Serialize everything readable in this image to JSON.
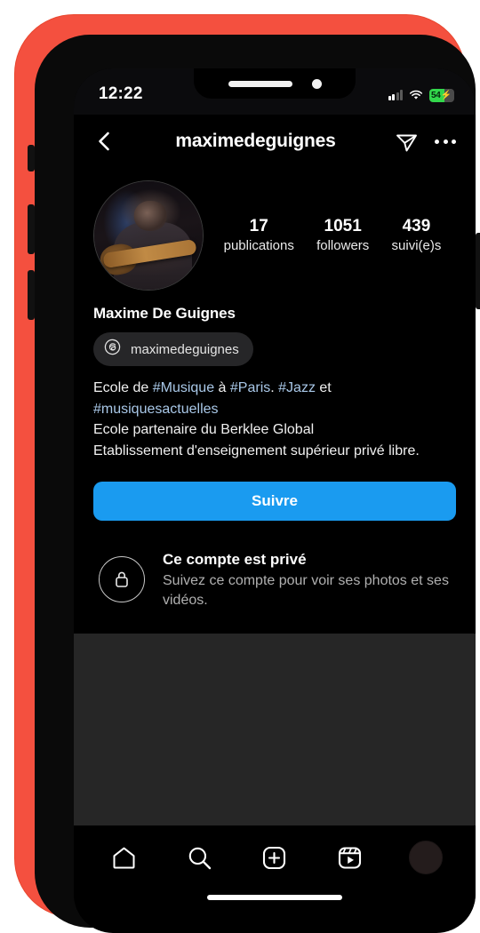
{
  "status_bar": {
    "time": "12:22",
    "battery_level": "54",
    "battery_charging_glyph": "⚡",
    "cellular_icon": "cellular-signal-icon",
    "wifi_icon": "wifi-icon"
  },
  "header": {
    "back_icon": "back-chevron-icon",
    "username": "maximedeguignes",
    "share_icon": "share-paper-plane-icon",
    "more_icon": "more-options-icon"
  },
  "profile": {
    "avatar_alt": "profile-photo-guitarist",
    "full_name": "Maxime De Guignes",
    "threads_handle": "maximedeguignes",
    "threads_icon": "threads-logo-icon",
    "stats": [
      {
        "value": "17",
        "label": "publications"
      },
      {
        "value": "1051",
        "label": "followers"
      },
      {
        "value": "439",
        "label": "suivi(e)s"
      }
    ],
    "bio_lines": [
      [
        {
          "t": "Ecole de ",
          "k": "plain"
        },
        {
          "t": "#Musique",
          "k": "tag"
        },
        {
          "t": " à ",
          "k": "plain"
        },
        {
          "t": "#Paris",
          "k": "tag"
        },
        {
          "t": ". ",
          "k": "plain"
        },
        {
          "t": "#Jazz",
          "k": "tag"
        },
        {
          "t": " et ",
          "k": "plain"
        },
        {
          "t": "#musiquesactuelles",
          "k": "tag"
        }
      ],
      [
        {
          "t": "Ecole partenaire du Berklee Global",
          "k": "plain"
        }
      ],
      [
        {
          "t": "Etablissement d'enseignement supérieur privé libre.",
          "k": "plain"
        }
      ]
    ],
    "follow_button_label": "Suivre",
    "follow_button_color": "#1A9BF0"
  },
  "private_notice": {
    "lock_icon": "lock-icon",
    "title": "Ce compte est privé",
    "subtitle": "Suivez ce compte pour voir ses photos et ses vidéos."
  },
  "bottom_nav": {
    "items": [
      {
        "name": "home-icon"
      },
      {
        "name": "search-icon"
      },
      {
        "name": "create-post-icon"
      },
      {
        "name": "reels-icon"
      },
      {
        "name": "profile-avatar-icon"
      }
    ]
  },
  "colors": {
    "frame": "#F4503F",
    "accent": "#1A9BF0",
    "hashtag": "#A9C8E8",
    "battery_green": "#32D74B",
    "empty_grid": "#262626"
  }
}
